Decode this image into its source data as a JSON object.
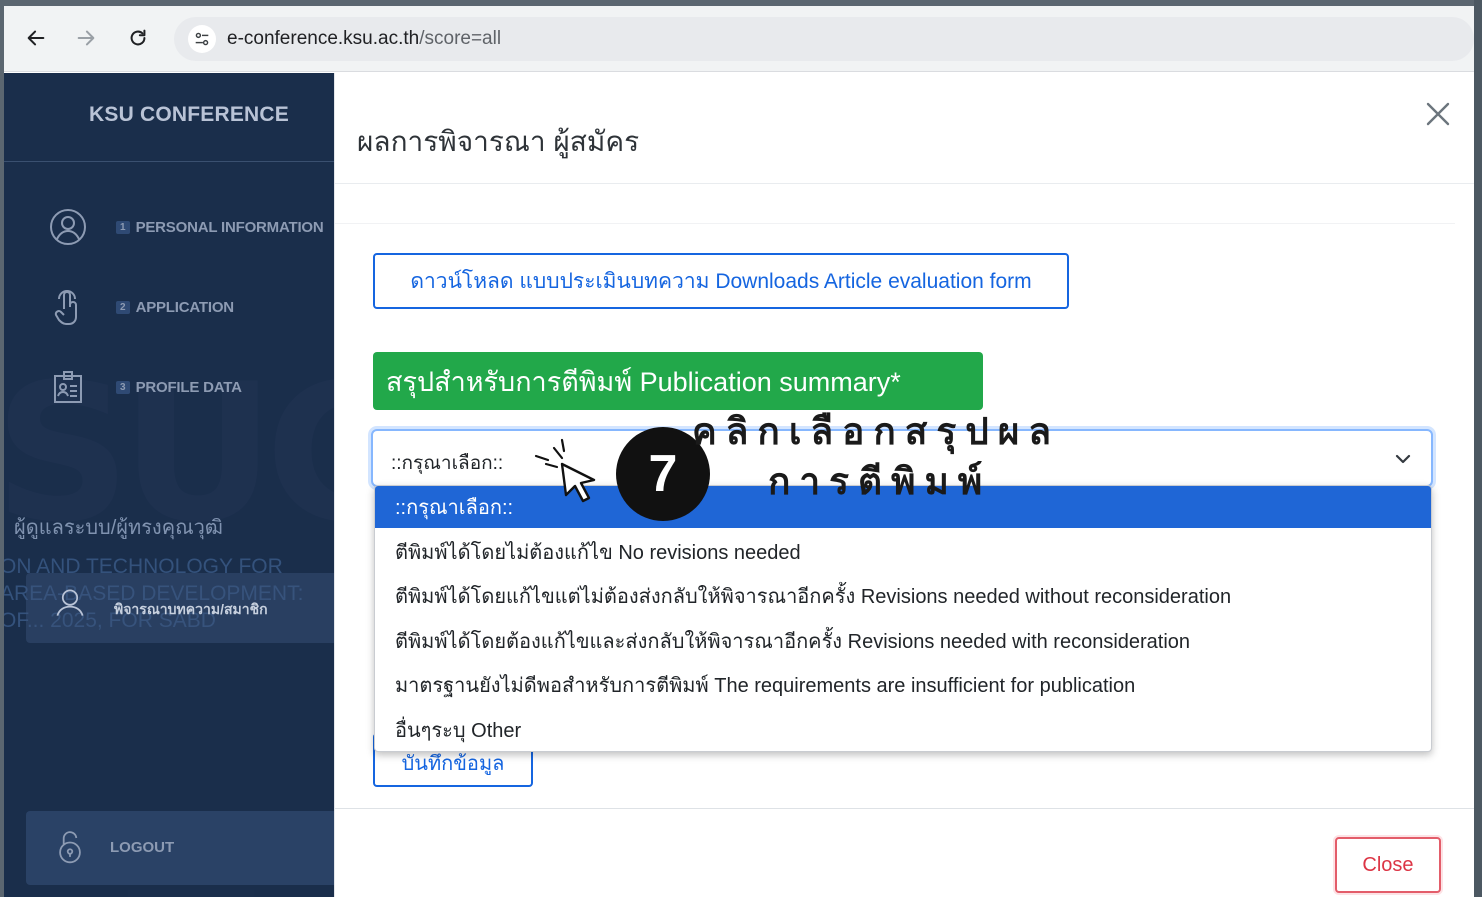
{
  "browser": {
    "url_host": "e-conference.ksu.ac.th",
    "url_path": "/score=all"
  },
  "sidebar": {
    "brand": "KSU CONFERENCE",
    "items": [
      {
        "number": "1",
        "label": "PERSONAL INFORMATION",
        "icon": "user-circle-icon"
      },
      {
        "number": "2",
        "label": "APPLICATION",
        "icon": "hand-pointer-icon"
      },
      {
        "number": "3",
        "label": "PROFILE DATA",
        "icon": "id-badge-icon"
      }
    ],
    "role": "ผู้ดูแลระบบ/ผู้ทรงคุณวุฒิ",
    "topic_line1": "ON AND TECHNOLOGY FOR",
    "topic_line2": "AREA-BASED DEVELOPMENT:",
    "topic_line3": "OF... 2025, FOR SABD",
    "review_item": "พิจารณาบทความ/สมาชิก",
    "logout": "LOGOUT"
  },
  "modal": {
    "title": "ผลการพิจารณา ผู้สมัคร",
    "download_button": "ดาวน์โหลด แบบประเมินบทความ Downloads Article evaluation form",
    "summary_label": "สรุปสำหรับการตีพิมพ์ Publication summary*",
    "select_value": "::กรุณาเลือก::",
    "options": [
      "::กรุณาเลือก::",
      "ตีพิมพ์ได้โดยไม่ต้องแก้ไข No revisions needed",
      "ตีพิมพ์ได้โดยแก้ไขแต่ไม่ต้องส่งกลับให้พิจารณาอีกครั้ง Revisions needed without reconsideration",
      "ตีพิมพ์ได้โดยต้องแก้ไขและส่งกลับให้พิจารณาอีกครั้ง Revisions needed with reconsideration",
      "มาตรฐานยังไม่ดีพอสำหรับการตีพิมพ์ The requirements are insufficient for publication",
      "อื่นๆระบุ Other"
    ],
    "save_button": "บันทึกข้อมูล",
    "close_button": "Close"
  },
  "annotation": {
    "step": "7",
    "line1": "คลิกเลือกสรุปผล",
    "line2": "การตีพิมพ์"
  },
  "colors": {
    "sidebar_bg": "#1e3554",
    "primary": "#1565e0",
    "success": "#22a84a",
    "danger": "#dc3545",
    "selected_option": "#1f66d6"
  }
}
